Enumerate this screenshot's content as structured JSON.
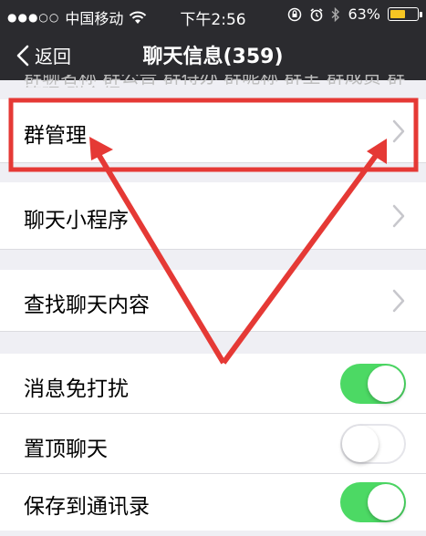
{
  "status_bar": {
    "carrier": "中国移动",
    "signal_dots": "●●●○○",
    "time": "下午2:56",
    "battery_percent_text": "63%",
    "battery_level": 0.63,
    "battery_color": "#f7c623"
  },
  "nav": {
    "back_label": "返回",
    "title": "聊天信息(359)"
  },
  "truncated_text": "群聊名称 群公告 群待办 群昵称 群主 群成员 群管理 群介绍",
  "rows": [
    {
      "label": "群管理",
      "chevron": true
    },
    {
      "label": "聊天小程序",
      "chevron": true
    },
    {
      "label": "查找聊天内容",
      "chevron": true
    }
  ],
  "toggles": [
    {
      "label": "消息免打扰",
      "on": true
    },
    {
      "label": "置顶聊天",
      "on": false
    },
    {
      "label": "保存到通讯录",
      "on": true
    }
  ],
  "colors": {
    "nav_bg": "#2b2b2f",
    "switch_on": "#4cd964",
    "annotation": "#e53935"
  }
}
